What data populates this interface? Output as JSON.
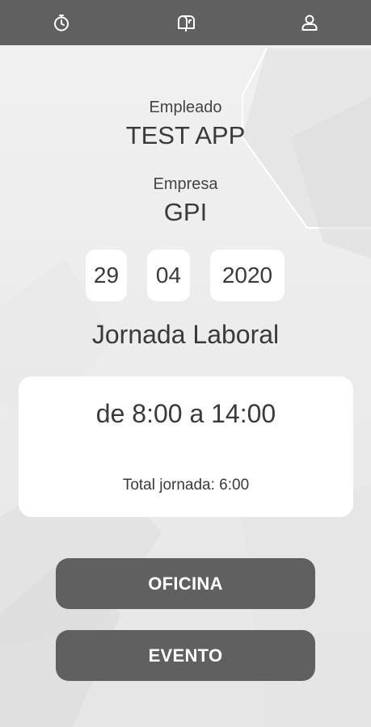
{
  "tabs": [
    {
      "icon": "stopwatch-icon"
    },
    {
      "icon": "mailbox-icon"
    },
    {
      "icon": "user-icon"
    }
  ],
  "employee": {
    "label": "Empleado",
    "value": "TEST APP"
  },
  "company": {
    "label": "Empresa",
    "value": "GPI"
  },
  "date": {
    "day": "29",
    "month": "04",
    "year": "2020"
  },
  "workday": {
    "title": "Jornada Laboral",
    "hours": "de 8:00 a 14:00",
    "total": "Total jornada: 6:00"
  },
  "buttons": {
    "office": "OFICINA",
    "event": "EVENTO"
  },
  "colors": {
    "bar": "#606060",
    "button": "#606060",
    "card": "#ffffff",
    "background": "#ececec"
  }
}
